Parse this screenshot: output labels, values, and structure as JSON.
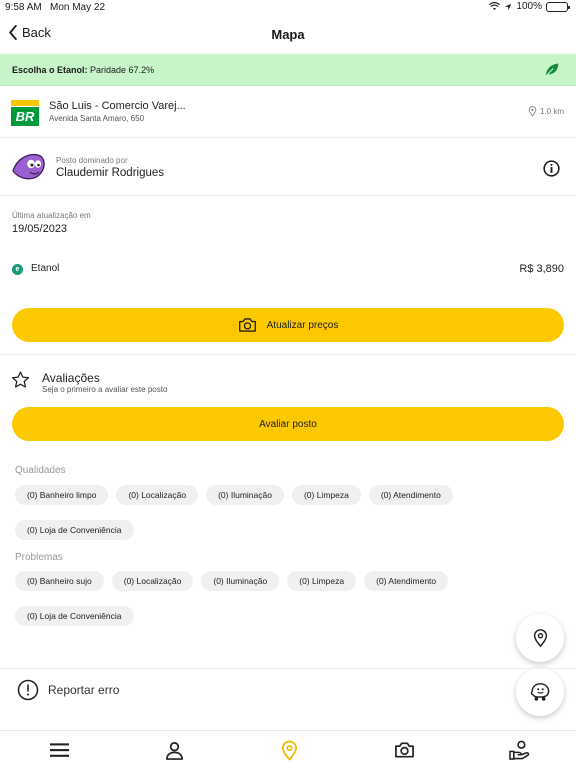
{
  "status_bar": {
    "time": "9:58 AM",
    "date": "Mon May 22",
    "battery": "100%"
  },
  "nav": {
    "back_label": "Back",
    "title": "Mapa"
  },
  "banner": {
    "lead": "Escolha o Etanol:",
    "detail": "Paridade 67.2%",
    "accent_color": "#c7f5c9",
    "icon": "leaf-icon"
  },
  "station": {
    "name": "São Luis - Comercio Varej...",
    "address": "Avenida Santa Amaro, 650",
    "distance": "1.0 km",
    "logo_text": "BR"
  },
  "owner": {
    "label": "Posto dominado por",
    "name": "Claudemir Rodrigues"
  },
  "update": {
    "label": "Última atualização em",
    "date": "19/05/2023"
  },
  "fuel": {
    "badge": "e",
    "name": "Etanol",
    "price": "R$ 3,890"
  },
  "buttons": {
    "update_prices": "Atualizar preços",
    "rate_station": "Avaliar posto",
    "accent_color": "#fcc900"
  },
  "reviews": {
    "title": "Avaliações",
    "subtitle": "Seja o primeiro a avaliar este posto"
  },
  "qualities": {
    "label": "Qualidades",
    "chips": [
      "(0) Banheiro limpo",
      "(0) Localização",
      "(0) Iluminação",
      "(0) Limpeza",
      "(0) Atendimento",
      "(0) Loja de Conveniência"
    ]
  },
  "problems": {
    "label": "Problemas",
    "chips": [
      "(0) Banheiro sujo",
      "(0) Localização",
      "(0) Iluminação",
      "(0) Limpeza",
      "(0) Atendimento",
      "(0) Loja de Conveniência"
    ]
  },
  "report": {
    "label": "Reportar erro"
  },
  "tabs": [
    "menu-icon",
    "profile-icon",
    "map-pin-icon",
    "camera-icon",
    "user-hand-icon"
  ],
  "active_tab_color": "#f2b800"
}
